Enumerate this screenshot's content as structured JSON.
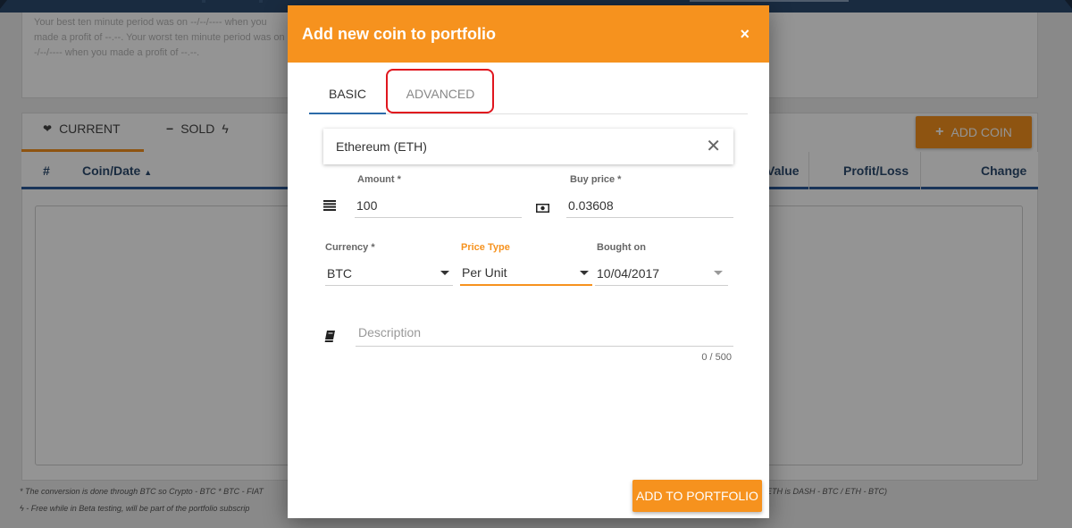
{
  "background": {
    "summary_text": "Your best ten minute period was on --/--/---- when you made a profit of --.--. Your worst ten minute period was on --/--/---- when you made a profit of --.--.",
    "tabs": [
      {
        "label": "CURRENT",
        "icon": "heartbeat-icon"
      },
      {
        "label": "SOLD",
        "icon": "minus-icon"
      }
    ],
    "add_coin_label": "ADD COIN",
    "table_headers": [
      "#",
      "Coin/Date",
      "Value",
      "Profit/Loss",
      "Change"
    ],
    "footnote_1": "* The conversion is done through BTC so Crypto - BTC * BTC - FIAT",
    "footnote_1_right": "ETH is DASH - BTC / ETH - BTC)",
    "footnote_2": "- Free while in Beta testing, will be part of the portfolio subscrip"
  },
  "modal": {
    "title": "Add new coin to portfolio",
    "close_symbol": "×",
    "tabs": {
      "basic": "BASIC",
      "advanced": "ADVANCED"
    },
    "coin": {
      "value": "Ethereum (ETH)",
      "clear_symbol": "✕"
    },
    "amount": {
      "label": "Amount *",
      "value": "100"
    },
    "buy_price": {
      "label": "Buy price *",
      "value": "0.03608"
    },
    "currency": {
      "label": "Currency *",
      "value": "BTC"
    },
    "price_type": {
      "label": "Price Type",
      "value": "Per Unit"
    },
    "bought_on": {
      "label": "Bought on",
      "value": "10/04/2017"
    },
    "description": {
      "placeholder": "Description",
      "count": "0 / 500"
    },
    "submit_label": "ADD TO PORTFOLIO"
  },
  "colors": {
    "accent": "#f6921e",
    "navy": "#2c4a6e",
    "tab_active": "#2c6aa8",
    "highlight": "#e0161e"
  }
}
